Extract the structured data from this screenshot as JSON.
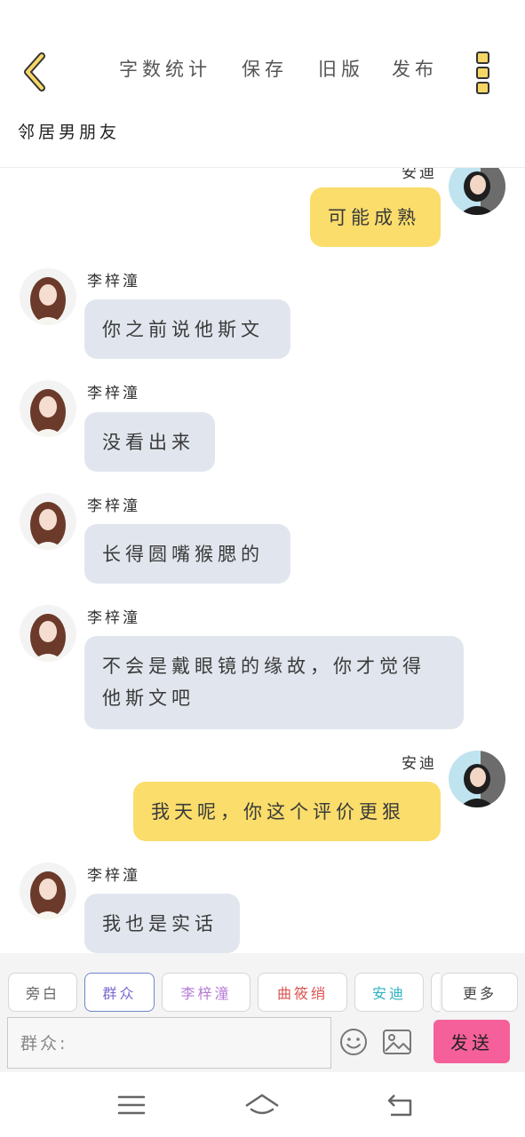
{
  "header": {
    "tools": [
      "字数统计",
      "保存",
      "旧版",
      "发布"
    ],
    "title": "邻居男朋友"
  },
  "chat": {
    "partial_name": "安迪",
    "messages": [
      {
        "side": "right",
        "name": "",
        "text": "可能成熟"
      },
      {
        "side": "left",
        "name": "李梓潼",
        "text": "你之前说他斯文"
      },
      {
        "side": "left",
        "name": "李梓潼",
        "text": "没看出来"
      },
      {
        "side": "left",
        "name": "李梓潼",
        "text": "长得圆嘴猴腮的"
      },
      {
        "side": "left",
        "name": "李梓潼",
        "text": "不会是戴眼镜的缘故，你才觉得他斯文吧"
      },
      {
        "side": "right",
        "name": "安迪",
        "text": "我天呢，你这个评价更狠"
      },
      {
        "side": "left",
        "name": "李梓潼",
        "text": "我也是实话"
      }
    ]
  },
  "roles": {
    "chips": [
      {
        "label": "旁白",
        "color": "#666666"
      },
      {
        "label": "群众",
        "color": "#7a6bd1"
      },
      {
        "label": "李梓潼",
        "color": "#b67ad6"
      },
      {
        "label": "曲筱绡",
        "color": "#d9534f"
      },
      {
        "label": "安迪",
        "color": "#2bb3c0"
      }
    ],
    "more_label": "更多"
  },
  "composer": {
    "placeholder": "群众:",
    "send_label": "发送"
  },
  "icons": {
    "back": "chevron-left-icon",
    "more": "more-vertical-icon",
    "emoji": "emoji-icon",
    "image": "image-icon",
    "menu": "menu-icon",
    "home": "home-icon",
    "return": "return-icon"
  },
  "colors": {
    "accent_yellow": "#fadd6b",
    "left_bubble": "#e1e6ee",
    "send_pink": "#f5609a"
  }
}
